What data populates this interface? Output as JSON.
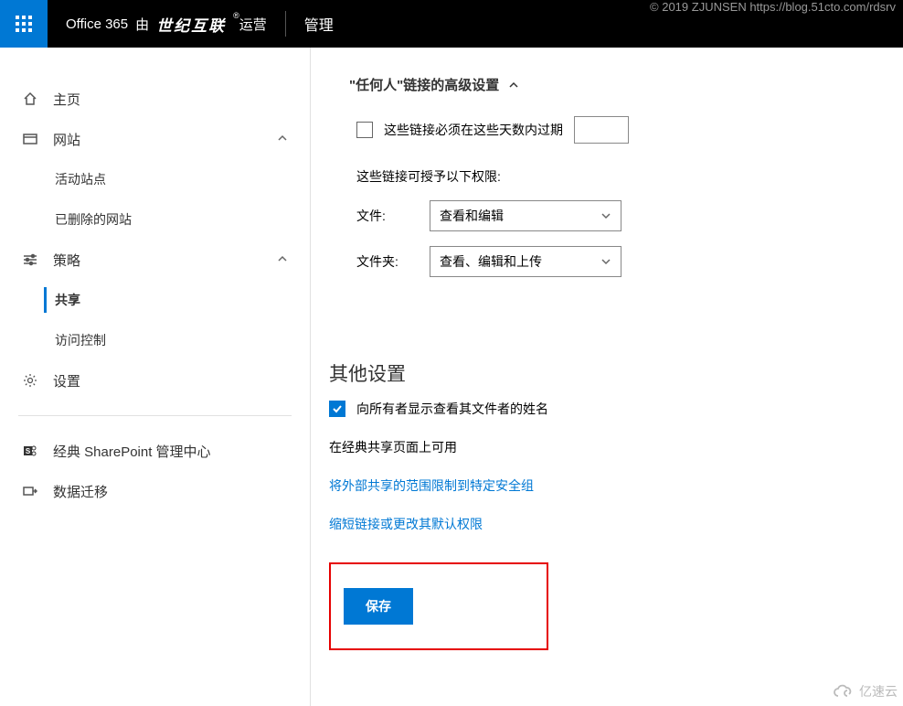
{
  "watermark_top": "© 2019 ZJUNSEN https://blog.51cto.com/rdsrv",
  "watermark_bottom": "亿速云",
  "header": {
    "brand_prefix": "Office 365",
    "brand_by": "由",
    "brand_bold": "世纪互联",
    "brand_suffix": "运营",
    "app_title": "管理"
  },
  "sidebar": {
    "home": "主页",
    "sites": "网站",
    "sites_sub": {
      "active": "活动站点",
      "deleted": "已删除的网站"
    },
    "policies": "策略",
    "policies_sub": {
      "sharing": "共享",
      "access": "访问控制"
    },
    "settings": "设置",
    "classic": "经典 SharePoint 管理中心",
    "migration": "数据迁移"
  },
  "main": {
    "anyone_section": "\"任何人\"链接的高级设置",
    "expire_label": "这些链接必须在这些天数内过期",
    "perms_label": "这些链接可授予以下权限:",
    "file_label": "文件:",
    "file_value": "查看和编辑",
    "folder_label": "文件夹:",
    "folder_value": "查看、编辑和上传",
    "other_heading": "其他设置",
    "show_owner": "向所有者显示查看其文件者的姓名",
    "classic_avail": "在经典共享页面上可用",
    "link1": "将外部共享的范围限制到特定安全组",
    "link2": "缩短链接或更改其默认权限",
    "save": "保存"
  }
}
